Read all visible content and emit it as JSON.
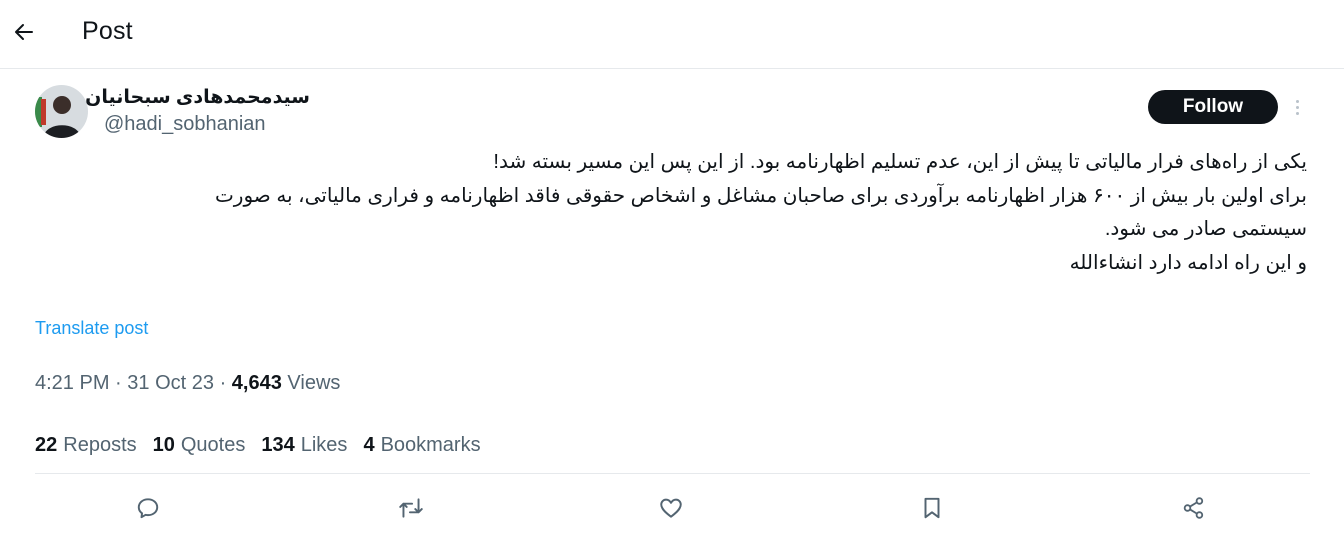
{
  "header": {
    "title": "Post",
    "back_icon": "arrow-left-icon"
  },
  "author": {
    "display_name": "سیدمحمدهادی سبحانیان",
    "handle": "@hadi_sobhanian",
    "follow_label": "Follow"
  },
  "post": {
    "lines": [
      "یکی از راه‌های فرار مالیاتی تا پیش از این، عدم تسلیم اظهارنامه بود. از این پس این مسیر بسته شد!",
      "برای اولین بار بیش از ۶۰۰ هزار اظهارنامه برآوردی برای صاحبان مشاغل و اشخاص حقوقی فاقد اظهارنامه و فراری مالیاتی، به صورت",
      "سیستمی صادر می شود.",
      "و این راه ادامه دارد انشاءالله"
    ],
    "translate_label": "Translate post",
    "time": "4:21 PM",
    "date": "31 Oct 23",
    "separator": "·",
    "views_count": "4,643",
    "views_label": "Views"
  },
  "stats": [
    {
      "count": "22",
      "label": "Reposts"
    },
    {
      "count": "10",
      "label": "Quotes"
    },
    {
      "count": "134",
      "label": "Likes"
    },
    {
      "count": "4",
      "label": "Bookmarks"
    }
  ],
  "actions": [
    "reply-icon",
    "repost-icon",
    "like-icon",
    "bookmark-icon",
    "share-icon"
  ],
  "colors": {
    "accent": "#1d9bf0",
    "text": "#0f1419",
    "secondary": "#536471",
    "border": "#e6e9ec"
  }
}
